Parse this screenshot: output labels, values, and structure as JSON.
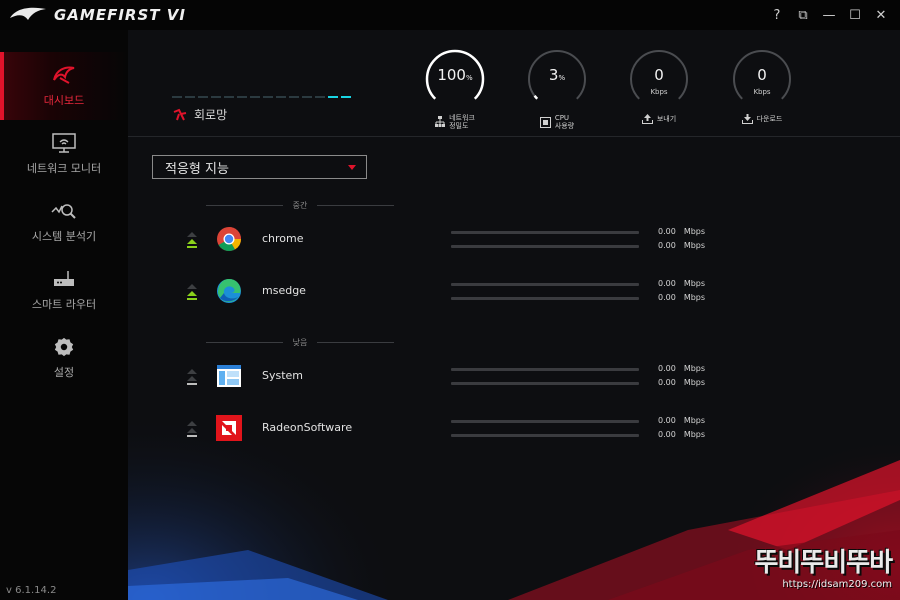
{
  "app": {
    "title": "GAMEFIRST VI",
    "version": "v 6.1.14.2"
  },
  "window_controls": [
    "?",
    "⧉",
    "—",
    "☐",
    "✕"
  ],
  "sidebar": {
    "items": [
      {
        "label": "대시보드",
        "icon": "dashboard-icon",
        "active": true
      },
      {
        "label": "네트워크 모니터",
        "icon": "monitor-wifi-icon",
        "active": false
      },
      {
        "label": "시스템 분석기",
        "icon": "system-analyzer-icon",
        "active": false
      },
      {
        "label": "스마트 라우터",
        "icon": "router-icon",
        "active": false
      },
      {
        "label": "설정",
        "icon": "gear-icon",
        "active": false
      }
    ]
  },
  "header": {
    "line_label": "회로망",
    "signal_level": 2,
    "signal_total": 14,
    "gauges": [
      {
        "value": "100",
        "unit_inline": "%",
        "unit_below": "",
        "caption": [
          "네트워크",
          "정밀도"
        ],
        "icon": "network-icon",
        "level": 1.0
      },
      {
        "value": "3",
        "unit_inline": "%",
        "unit_below": "",
        "caption": [
          "CPU",
          "사용량"
        ],
        "icon": "cpu-icon",
        "level": 0.03
      },
      {
        "value": "0",
        "unit_inline": "",
        "unit_below": "Kbps",
        "caption": [
          "보내기"
        ],
        "icon": "upload-icon",
        "level": 0
      },
      {
        "value": "0",
        "unit_inline": "",
        "unit_below": "Kbps",
        "caption": [
          "다운로드"
        ],
        "icon": "download-icon",
        "level": 0
      }
    ]
  },
  "mode_select": {
    "value": "적응형 지능"
  },
  "groups": [
    {
      "label": "중간",
      "apps": [
        {
          "name": "chrome",
          "icon": "chrome-icon",
          "priority": "medium",
          "up": "0.00",
          "down": "0.00",
          "unit": "Mbps",
          "up_level": 0,
          "down_level": 0
        },
        {
          "name": "msedge",
          "icon": "edge-icon",
          "priority": "medium",
          "up": "0.00",
          "down": "0.00",
          "unit": "Mbps",
          "up_level": 0,
          "down_level": 0
        }
      ]
    },
    {
      "label": "낮음",
      "apps": [
        {
          "name": "System",
          "icon": "system-window-icon",
          "priority": "low",
          "up": "0.00",
          "down": "0.00",
          "unit": "Mbps",
          "up_level": 0,
          "down_level": 0
        },
        {
          "name": "RadeonSoftware",
          "icon": "amd-icon",
          "priority": "low",
          "up": "0.00",
          "down": "0.00",
          "unit": "Mbps",
          "up_level": 0,
          "down_level": 0
        }
      ]
    }
  ],
  "watermark": {
    "logo_text": "뚜비뚜비뚜바",
    "url": "https://idsam209.com"
  },
  "colors": {
    "accent": "#e0132b",
    "cyan": "#19d5e4",
    "bg": "#0d0e11",
    "sidebar": "#060606"
  }
}
